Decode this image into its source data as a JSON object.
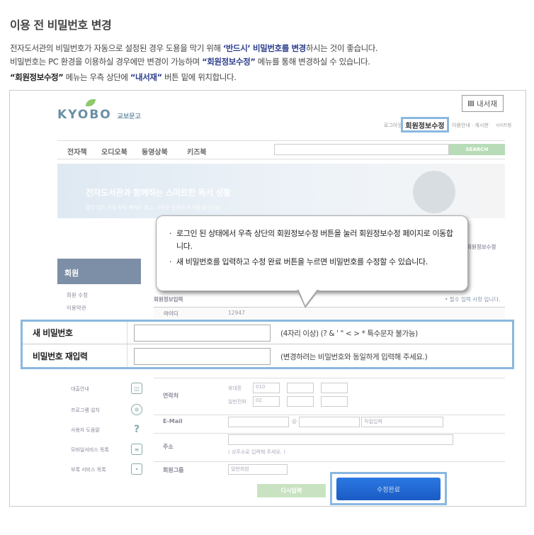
{
  "page": {
    "title": "이용 전 비밀번호 변경",
    "line1_pre": "전자도서관의 비밀번호가 자동으로 설정된 경우 도용을 막기 위해 ",
    "line1_bold": "‘반드시’ 비밀번호를 변경",
    "line1_post": "하시는 것이 좋습니다.",
    "line2_pre": "비밀번호는 PC 환경을 이용하실 경우에만 변경이 가능하며 ",
    "line2_bold": "“회원정보수정”",
    "line2_post": " 메뉴를 통해 변경하실 수 있습니다.",
    "line3_bold1": "“회원정보수정”",
    "line3_mid": " 메뉴는 우측 상단에 ",
    "line3_bold2": "“내서재”",
    "line3_post": " 버튼 밑에 위치합니다."
  },
  "site": {
    "logo": "KYOBO",
    "logo_sub": "교보문고",
    "my_library": "내서재",
    "util_login": "로그아웃",
    "util_info": "이용안내 · 게시판",
    "util_sitemap": "사이트맵",
    "edit_member": "회원정보수정",
    "gnb": [
      "전자책",
      "오디오북",
      "동영상북",
      "키즈북"
    ],
    "search_btn": "SEARCH",
    "banner_main": "전자도서관과 함께하는 스마트한 독서 생활",
    "banner_sub": "멀리 있는 서점 찾아 헤매지 말고, 가까운 곳에서 독서를 즐기세요.",
    "breadcrumb": "회원정보수정",
    "lnb_title": "회원",
    "lnb_items": [
      "회원 수정",
      "이용약관"
    ],
    "sec_title": "회원정보입력",
    "sec_req": "• 필수 입력 사항 입니다.",
    "id_label": "아이디",
    "id_value": "12947"
  },
  "tooltip": {
    "items": [
      "로그인 된 상태에서 우측 상단의 회원정보수정 버튼을 눌러 회원정보수정 페이지로 이동합니다.",
      "새 비밀번호를 입력하고 수정 완료 버튼을 누르면 비밀번호를 수정할 수 있습니다."
    ]
  },
  "form": {
    "new_pw_label": "새 비밀번호",
    "new_pw_hint": "(4자리 이상) (? & ' \" < > * 특수문자 불가능)",
    "confirm_pw_label": "비밀번호 재입력",
    "confirm_pw_hint": "(변경하려는 비밀번호와 동일하게 입력해 주세요.)"
  },
  "sidebar": {
    "items": [
      "대출안내",
      "프로그램 설치",
      "사용자 도움말",
      "모바일서비스 목록",
      "부록 서비스 목록"
    ],
    "icons": [
      "book-icon",
      "gear-icon",
      "help-icon",
      "mobile-icon",
      "box-icon"
    ]
  },
  "fields": {
    "phone_label": "연락처",
    "mobile": "휴대폰",
    "home": "일반전화",
    "mobile_prefix": "010",
    "home_prefix": "02",
    "email_label": "E-Mail",
    "email_sel": "직접입력",
    "addr_label": "주소",
    "addr_hint": "( 상주소로 입력해 주세요. )",
    "group_label": "회원그룹",
    "group_sel": "일반회원"
  },
  "buttons": {
    "reset": "다시입력",
    "submit": "수정완료"
  }
}
